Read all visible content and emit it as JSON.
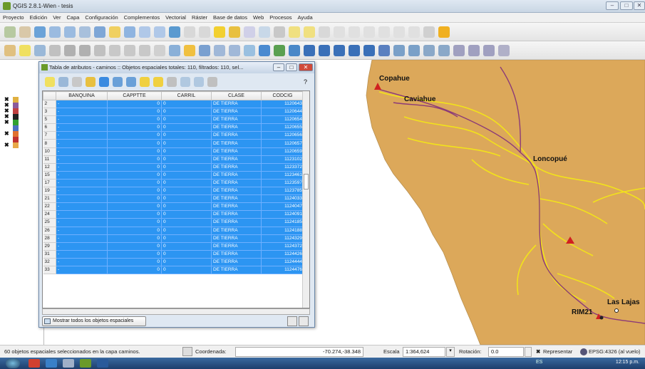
{
  "window": {
    "title": "QGIS 2.8.1-Wien - tesis",
    "minimize_label": "–",
    "maximize_label": "□",
    "close_label": "✕"
  },
  "menubar": {
    "items": [
      "Proyecto",
      "Edición",
      "Ver",
      "Capa",
      "Configuración",
      "Complementos",
      "Vectorial",
      "Ráster",
      "Base de datos",
      "Web",
      "Procesos",
      "Ayuda"
    ]
  },
  "layers": {
    "symbols": [
      "#e0b040",
      "#8b5a9a",
      "#c04040",
      "#222222",
      "#30a030",
      "#4a70c0",
      "#e07030",
      "#c03030",
      "#e8a848"
    ]
  },
  "attribute_table": {
    "title": "Tabla de atributos - caminos :: Objetos espaciales totales: 110, filtrados: 110, sel...",
    "columns": [
      "BANQUINA",
      "CAPPTTE",
      "CARRIL",
      "CLASE",
      "CODCIG"
    ],
    "rows": [
      {
        "n": "2",
        "banquina": "-",
        "capptte": "0",
        "carril": "0",
        "clase": "DE TIERRA",
        "codcig": "1120643"
      },
      {
        "n": "3",
        "banquina": "-",
        "capptte": "0",
        "carril": "0",
        "clase": "DE TIERRA",
        "codcig": "1120644"
      },
      {
        "n": "5",
        "banquina": "-",
        "capptte": "0",
        "carril": "0",
        "clase": "DE TIERRA",
        "codcig": "1120654"
      },
      {
        "n": "6",
        "banquina": "-",
        "capptte": "0",
        "carril": "0",
        "clase": "DE TIERRA",
        "codcig": "1120655"
      },
      {
        "n": "7",
        "banquina": "-",
        "capptte": "0",
        "carril": "0",
        "clase": "DE TIERRA",
        "codcig": "1120656"
      },
      {
        "n": "8",
        "banquina": "-",
        "capptte": "0",
        "carril": "0",
        "clase": "DE TIERRA",
        "codcig": "1120657"
      },
      {
        "n": "10",
        "banquina": "-",
        "capptte": "0",
        "carril": "0",
        "clase": "DE TIERRA",
        "codcig": "1120659"
      },
      {
        "n": "11",
        "banquina": "-",
        "capptte": "0",
        "carril": "0",
        "clase": "DE TIERRA",
        "codcig": "1123102"
      },
      {
        "n": "12",
        "banquina": "-",
        "capptte": "0",
        "carril": "0",
        "clase": "DE TIERRA",
        "codcig": "1123372"
      },
      {
        "n": "15",
        "banquina": "-",
        "capptte": "0",
        "carril": "0",
        "clase": "DE TIERRA",
        "codcig": "1123461"
      },
      {
        "n": "17",
        "banquina": "-",
        "capptte": "0",
        "carril": "0",
        "clase": "DE TIERRA",
        "codcig": "1123597"
      },
      {
        "n": "19",
        "banquina": "-",
        "capptte": "0",
        "carril": "0",
        "clase": "DE TIERRA",
        "codcig": "1123785"
      },
      {
        "n": "21",
        "banquina": "-",
        "capptte": "0",
        "carril": "0",
        "clase": "DE TIERRA",
        "codcig": "1124033"
      },
      {
        "n": "22",
        "banquina": "-",
        "capptte": "0",
        "carril": "0",
        "clase": "DE TIERRA",
        "codcig": "1124047"
      },
      {
        "n": "24",
        "banquina": "-",
        "capptte": "0",
        "carril": "0",
        "clase": "DE TIERRA",
        "codcig": "1124091"
      },
      {
        "n": "25",
        "banquina": "-",
        "capptte": "0",
        "carril": "0",
        "clase": "DE TIERRA",
        "codcig": "1124185"
      },
      {
        "n": "26",
        "banquina": "-",
        "capptte": "0",
        "carril": "0",
        "clase": "DE TIERRA",
        "codcig": "1124188"
      },
      {
        "n": "28",
        "banquina": "-",
        "capptte": "0",
        "carril": "0",
        "clase": "DE TIERRA",
        "codcig": "1124329"
      },
      {
        "n": "29",
        "banquina": "-",
        "capptte": "0",
        "carril": "0",
        "clase": "DE TIERRA",
        "codcig": "1124372"
      },
      {
        "n": "31",
        "banquina": "-",
        "capptte": "0",
        "carril": "0",
        "clase": "DE TIERRA",
        "codcig": "1124426"
      },
      {
        "n": "32",
        "banquina": "-",
        "capptte": "0",
        "carril": "0",
        "clase": "DE TIERRA",
        "codcig": "1124444"
      },
      {
        "n": "33",
        "banquina": "-",
        "capptte": "0",
        "carril": "0",
        "clase": "DE TIERRA",
        "codcig": "1124476"
      }
    ],
    "selection_color": "#2c95f2",
    "filter_label": "Mostrar todos los objetos espaciales"
  },
  "map": {
    "background": "#ffffff",
    "land_color": "#dca85a",
    "road_color": "#f2e21b",
    "river_color": "#8b3a78",
    "places": [
      "Copahue",
      "Caviahue",
      "Loncopué",
      "Las Lajas",
      "RIM21"
    ]
  },
  "statusbar": {
    "message": "60 objetos espaciales seleccionados en la capa caminos.",
    "coord_label": "Coordenada:",
    "coord_value": "-70.274,-38.348",
    "scale_label": "Escala",
    "scale_value": "1:364,624",
    "rotation_label": "Rotación:",
    "rotation_value": "0.0",
    "render_label": "Representar",
    "crs_label": "EPSG:4326 (al vuelo)"
  },
  "taskbar": {
    "language": "ES",
    "clock": "12:15 p.m."
  }
}
